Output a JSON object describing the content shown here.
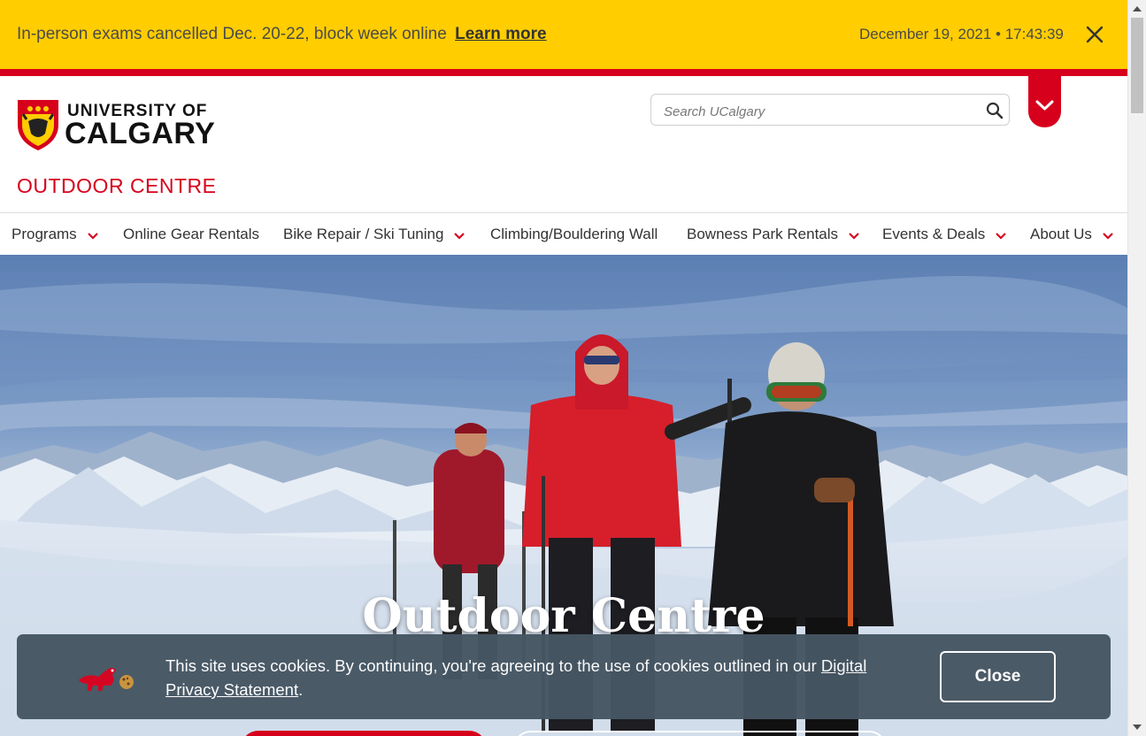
{
  "alert": {
    "message": "In-person exams cancelled Dec. 20-22, block week online",
    "link_label": "Learn more",
    "datetime": "December 19, 2021 • 17:43:39"
  },
  "header": {
    "logo_line1": "UNIVERSITY OF",
    "logo_line2": "CALGARY",
    "site_title": "OUTDOOR CENTRE",
    "search_placeholder": "Search UCalgary"
  },
  "nav": {
    "items": [
      {
        "label": "Programs",
        "has_menu": true
      },
      {
        "label": "Online Gear Rentals",
        "has_menu": false
      },
      {
        "label": "Bike Repair / Ski Tuning",
        "has_menu": true
      },
      {
        "label": "Climbing/Bouldering Wall",
        "has_menu": false
      },
      {
        "label": "Bowness Park Rentals",
        "has_menu": true
      },
      {
        "label": "Events & Deals",
        "has_menu": true
      },
      {
        "label": "About Us",
        "has_menu": true
      }
    ]
  },
  "hero": {
    "title": "Outdoor Centre"
  },
  "cookie": {
    "text_before": "This site uses cookies. By continuing, you're agreeing to the use of cookies outlined in our ",
    "link_label": "Digital Privacy Statement",
    "text_after": ".",
    "close_label": "Close"
  },
  "colors": {
    "brand_red": "#d6001c",
    "alert_yellow": "#ffcd00",
    "cookie_bg": "#465663"
  }
}
